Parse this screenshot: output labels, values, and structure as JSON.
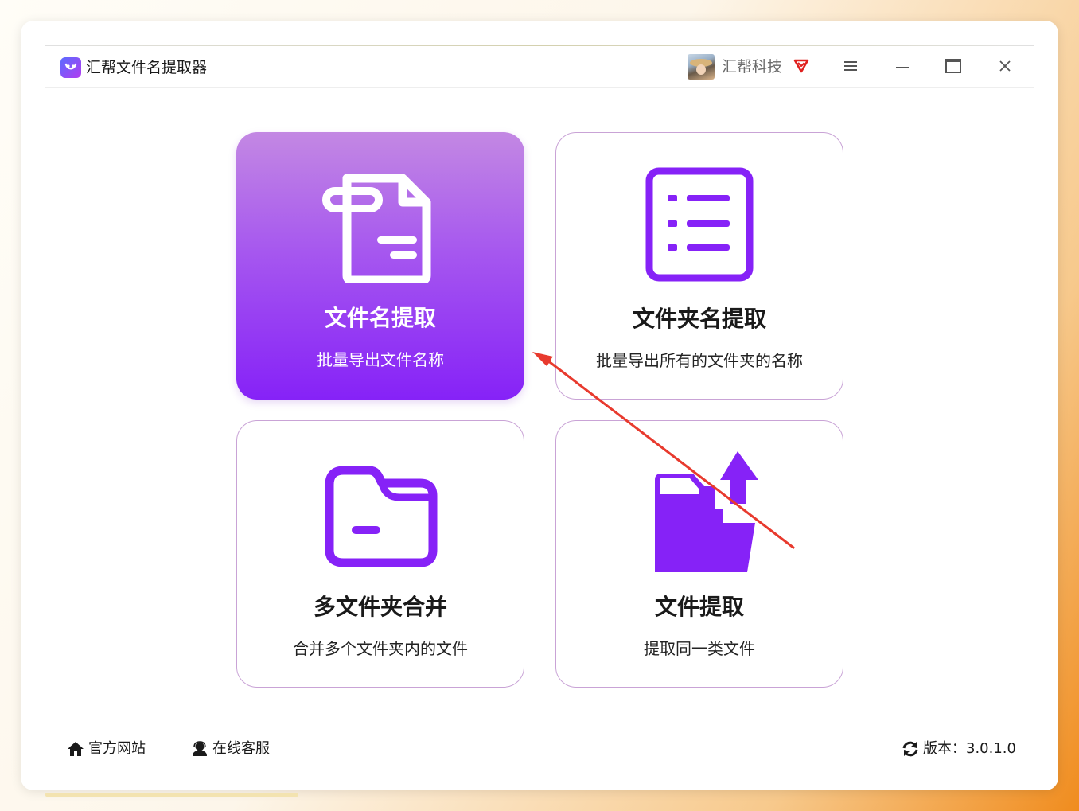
{
  "app": {
    "title": "汇帮文件名提取器",
    "user_name": "汇帮科技"
  },
  "tiles": [
    {
      "title": "文件名提取",
      "desc": "批量导出文件名称",
      "icon": "file-document-icon",
      "active": true
    },
    {
      "title": "文件夹名提取",
      "desc": "批量导出所有的文件夹的名称",
      "icon": "list-document-icon",
      "active": false
    },
    {
      "title": "多文件夹合并",
      "desc": "合并多个文件夹内的文件",
      "icon": "folder-icon",
      "active": false
    },
    {
      "title": "文件提取",
      "desc": "提取同一类文件",
      "icon": "folder-upload-icon",
      "active": false
    }
  ],
  "footer": {
    "website_label": "官方网站",
    "service_label": "在线客服",
    "version_label": "版本：3.0.1.0"
  },
  "colors": {
    "accent": "#8622f7",
    "accent_light": "#c388e3",
    "arrow": "#e83a2e",
    "vip": "#e0201e"
  }
}
